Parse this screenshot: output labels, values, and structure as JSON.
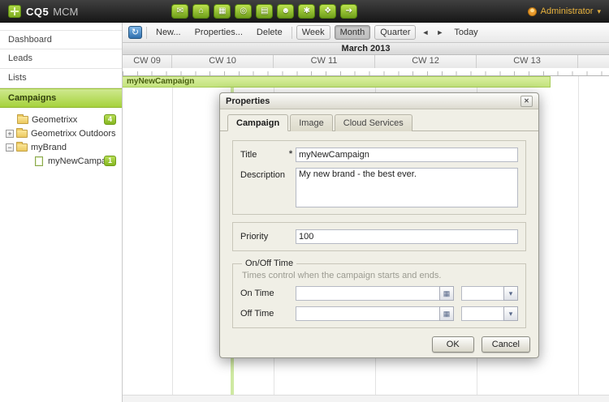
{
  "topbar": {
    "brand": "CQ5",
    "brand_suffix": "MCM",
    "user_label": "Administrator",
    "caret_glyph": "▾",
    "icons": [
      {
        "name": "inbox",
        "glyph": "✉"
      },
      {
        "name": "websites",
        "glyph": "⌂"
      },
      {
        "name": "assets",
        "glyph": "▦"
      },
      {
        "name": "campaigns",
        "glyph": "◎"
      },
      {
        "name": "reports",
        "glyph": "▤"
      },
      {
        "name": "users",
        "glyph": "☻"
      },
      {
        "name": "tools",
        "glyph": "✱"
      },
      {
        "name": "tagging",
        "glyph": "❖"
      },
      {
        "name": "workflow",
        "glyph": "➔"
      }
    ]
  },
  "sidebar": {
    "items": [
      {
        "label": "Dashboard"
      },
      {
        "label": "Leads"
      },
      {
        "label": "Lists"
      },
      {
        "label": "Campaigns"
      }
    ],
    "tree": [
      {
        "label": "Geometrixx",
        "badge": "4",
        "expander": ""
      },
      {
        "label": "Geometrixx Outdoors",
        "badge": "",
        "expander": "+"
      },
      {
        "label": "myBrand",
        "badge": "",
        "expander": "−"
      },
      {
        "label": "myNewCampaign",
        "badge": "1",
        "expander": ""
      }
    ]
  },
  "toolbar": {
    "refresh_glyph": "↻",
    "new": "New...",
    "properties": "Properties...",
    "delete": "Delete",
    "week": "Week",
    "month": "Month",
    "quarter": "Quarter",
    "prev_glyph": "◄",
    "next_glyph": "►",
    "today": "Today"
  },
  "calendar": {
    "month_title": "March 2013",
    "weeks": [
      "CW 09",
      "CW 10",
      "CW 11",
      "CW 12",
      "CW 13"
    ],
    "campaign_label": "myNewCampaign"
  },
  "dialog": {
    "title": "Properties",
    "close_glyph": "✕",
    "tabs": [
      "Campaign",
      "Image",
      "Cloud Services"
    ],
    "title_label": "Title",
    "required_marker": "*",
    "title_value": "myNewCampaign",
    "description_label": "Description",
    "description_value": "My new brand - the best ever.",
    "priority_label": "Priority",
    "priority_value": "100",
    "onoff_legend": "On/Off Time",
    "onoff_hint": "Times control when the campaign starts and ends.",
    "ontime_label": "On Time",
    "offtime_label": "Off Time",
    "calendar_trigger_glyph": "▦",
    "dropdown_glyph": "▾",
    "ok": "OK",
    "cancel": "Cancel"
  },
  "colors": {
    "accent_green": "#a6d23c",
    "topbar_black": "#161616",
    "dialog_beige": "#f0efe6"
  }
}
